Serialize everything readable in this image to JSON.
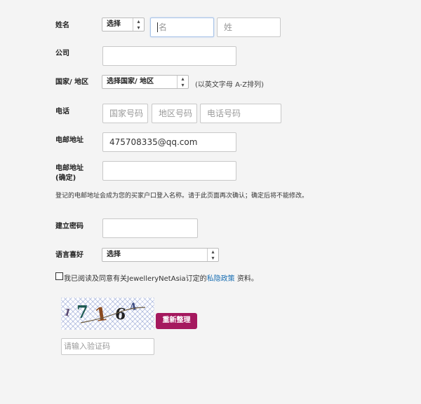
{
  "name_row": {
    "label": "姓名",
    "title_select": "选择",
    "first_name_placeholder": "名",
    "last_name_placeholder": "姓"
  },
  "company": {
    "label": "公司",
    "value": ""
  },
  "country": {
    "label": "国家/ 地区",
    "select_value": "选择国家/ 地区",
    "hint": "(以英文字母 A-Z排列)"
  },
  "phone": {
    "label": "电话",
    "country_code_placeholder": "国家号码",
    "area_code_placeholder": "地区号码",
    "number_placeholder": "电话号码"
  },
  "email": {
    "label": "电邮地址",
    "value": "475708335@qq.com"
  },
  "email_confirm": {
    "label_line1": "电邮地址",
    "label_line2": "(确定)",
    "value": ""
  },
  "email_note": "登记的电邮地址会成为您的买家户口登入名称。请于此页面再次确认；确定后将不能修改。",
  "password": {
    "label": "建立密码",
    "value": ""
  },
  "language": {
    "label": "语言喜好",
    "select_value": "选择"
  },
  "agreement": {
    "checked": false,
    "text_before": "我已阅读及同意有关JewelleryNetAsia订定的",
    "link_text": "私隐政策",
    "text_after": " 资料。"
  },
  "captcha": {
    "chars": [
      "1",
      "7",
      "1",
      "6",
      "4"
    ],
    "refresh_label": "重新整理",
    "input_placeholder": "请输入验证码",
    "colors": {
      "button_bg": "#a5195f",
      "link": "#1a6fb3"
    }
  },
  "icons": {
    "select_arrow": "up-down-arrow-icon"
  }
}
